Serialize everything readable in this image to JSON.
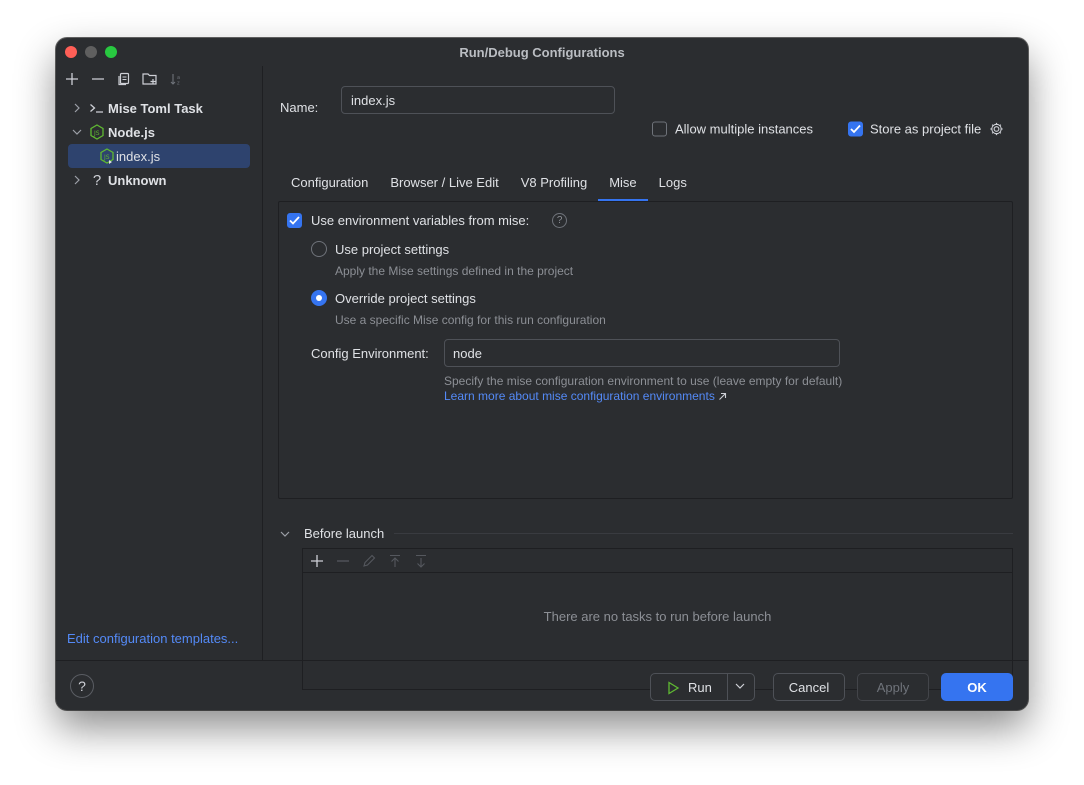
{
  "window": {
    "title": "Run/Debug Configurations"
  },
  "sidebar": {
    "toolbar": [
      "add-icon",
      "remove-icon",
      "copy-icon",
      "new-folder-icon",
      "sort-icon"
    ],
    "items": [
      {
        "label": "Mise Toml Task",
        "icon": "terminal-icon",
        "expanded": false
      },
      {
        "label": "Node.js",
        "icon": "nodejs-icon",
        "expanded": true
      },
      {
        "label": "index.js",
        "icon": "nodejs-config-icon",
        "selected": true
      },
      {
        "label": "Unknown",
        "icon": "question-icon",
        "expanded": false
      }
    ],
    "edit_templates": "Edit configuration templates..."
  },
  "header": {
    "name_label": "Name:",
    "name_value": "index.js",
    "allow_multiple": "Allow multiple instances",
    "store_project": "Store as project file"
  },
  "tabs": [
    "Configuration",
    "Browser / Live Edit",
    "V8 Profiling",
    "Mise",
    "Logs"
  ],
  "mise": {
    "use_env": "Use environment variables from mise:",
    "project_settings": "Use project settings",
    "project_settings_hint": "Apply the Mise settings defined in the project",
    "override_settings": "Override project settings",
    "override_settings_hint": "Use a specific Mise config for this run configuration",
    "config_env_label": "Config Environment:",
    "config_env_value": "node",
    "config_env_hint": "Specify the mise configuration environment to use (leave empty for default)",
    "learn_more": "Learn more about mise configuration environments"
  },
  "before_launch": {
    "label": "Before launch",
    "empty": "There are no tasks to run before launch"
  },
  "footer": {
    "help": "?",
    "run": "Run",
    "cancel": "Cancel",
    "apply": "Apply",
    "ok": "OK"
  },
  "colors": {
    "accent": "#3574f0",
    "link": "#548af7",
    "background": "#2b2d30"
  }
}
